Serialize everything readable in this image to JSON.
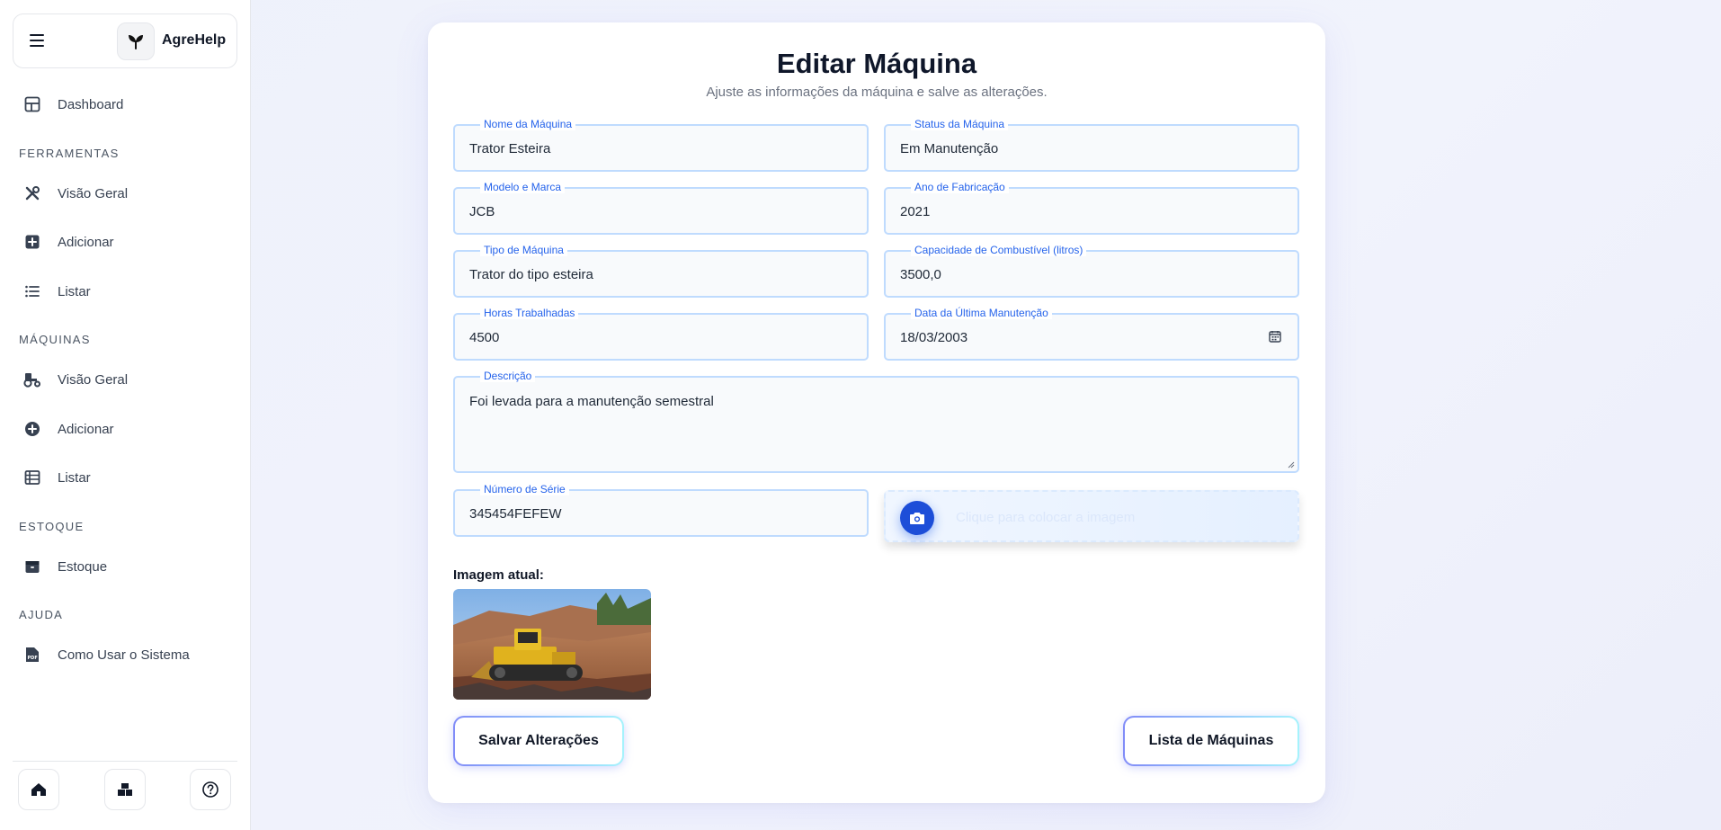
{
  "app": {
    "name": "AgreHelp"
  },
  "sidebar": {
    "dashboard": "Dashboard",
    "sections": {
      "ferramentas": "FERRAMENTAS",
      "maquinas": "MÁQUINAS",
      "estoque": "ESTOQUE",
      "ajuda": "AJUDA"
    },
    "ferramentas": {
      "overview": "Visão Geral",
      "add": "Adicionar",
      "list": "Listar"
    },
    "maquinas": {
      "overview": "Visão Geral",
      "add": "Adicionar",
      "list": "Listar"
    },
    "estoque": {
      "item": "Estoque"
    },
    "ajuda": {
      "item": "Como Usar o Sistema"
    }
  },
  "page": {
    "title": "Editar Máquina",
    "subtitle": "Ajuste as informações da máquina e salve as alterações."
  },
  "form": {
    "nome": {
      "label": "Nome da Máquina",
      "value": "Trator Esteira"
    },
    "status": {
      "label": "Status da Máquina",
      "value": "Em Manutenção"
    },
    "modelo": {
      "label": "Modelo e Marca",
      "value": "JCB"
    },
    "ano": {
      "label": "Ano de Fabricação",
      "value": "2021"
    },
    "tipo": {
      "label": "Tipo de Máquina",
      "value": "Trator do tipo esteira"
    },
    "capacidade": {
      "label": "Capacidade de Combustível (litros)",
      "value": "3500,0"
    },
    "horas": {
      "label": "Horas Trabalhadas",
      "value": "4500"
    },
    "data": {
      "label": "Data da Última Manutenção",
      "value": "18/03/2003"
    },
    "descricao": {
      "label": "Descrição",
      "value": "Foi levada para a manutenção semestral"
    },
    "serie": {
      "label": "Número de Série",
      "value": "345454FEFEW"
    },
    "upload": {
      "text": "Clique para colocar a imagem"
    },
    "image_label": "Imagem atual:"
  },
  "actions": {
    "save": "Salvar Alterações",
    "list": "Lista de Máquinas"
  },
  "colors": {
    "accent": "#2563eb",
    "field_border": "#bfdbfe",
    "camera": "#1d4ed8"
  }
}
